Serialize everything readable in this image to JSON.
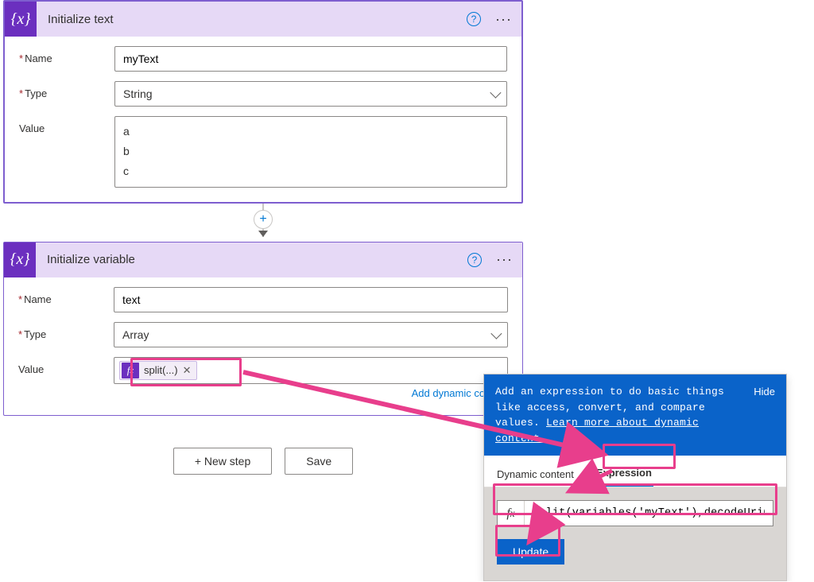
{
  "action1": {
    "title": "Initialize text",
    "icon": "{x}",
    "fields": {
      "name_label": "Name",
      "name_value": "myText",
      "type_label": "Type",
      "type_value": "String",
      "value_label": "Value",
      "value_text": "a\nb\nc"
    }
  },
  "action2": {
    "title": "Initialize variable",
    "icon": "{x}",
    "fields": {
      "name_label": "Name",
      "name_value": "text",
      "type_label": "Type",
      "type_value": "Array",
      "value_label": "Value",
      "chip_label": "split(...)"
    },
    "dyn_link": "Add dynamic content"
  },
  "footer": {
    "new_step": "+ New step",
    "save": "Save"
  },
  "expr_panel": {
    "banner_text": "Add an expression to do basic things like access, convert, and compare values. ",
    "learn_more": "Learn more about dynamic content.",
    "hide": "Hide",
    "tab_dynamic": "Dynamic content",
    "tab_expression": "Expression",
    "formula": "split(variables('myText'),decodeUriComponent",
    "update": "Update"
  }
}
